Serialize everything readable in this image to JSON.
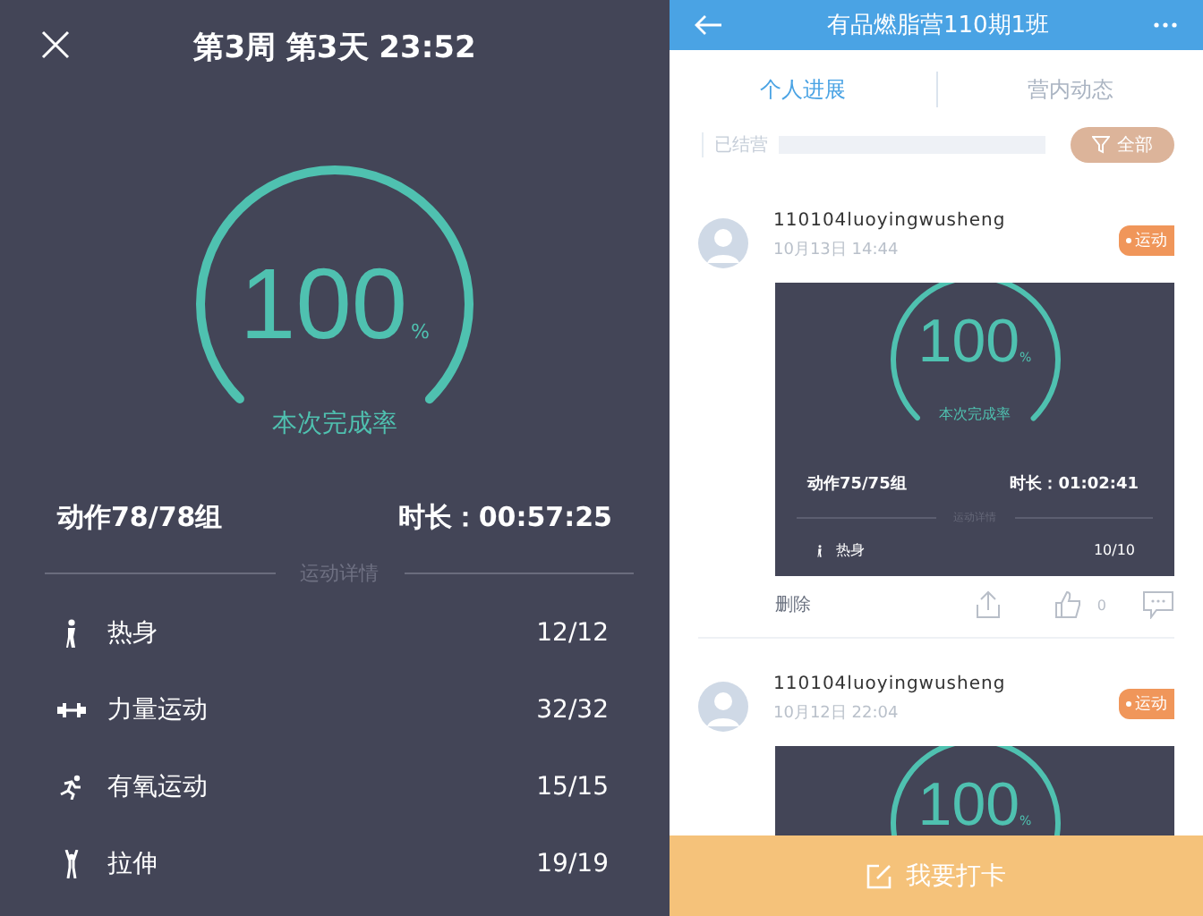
{
  "workout": {
    "title": "第3周 第3天 23:52",
    "completion": {
      "value": "100",
      "unit": "%",
      "label": "本次完成率"
    },
    "sets": "动作78/78组",
    "duration": "时长：00:57:25",
    "details_heading": "运动详情",
    "categories": [
      {
        "kind": "warmup",
        "name": "热身",
        "count": "12/12"
      },
      {
        "kind": "strength",
        "name": "力量运动",
        "count": "32/32"
      },
      {
        "kind": "cardio",
        "name": "有氧运动",
        "count": "15/15"
      },
      {
        "kind": "stretch",
        "name": "拉伸",
        "count": "19/19"
      }
    ]
  },
  "feed": {
    "title": "有品燃脂营110期1班",
    "tabs": [
      {
        "label": "个人进展",
        "selected": true
      },
      {
        "label": "营内动态",
        "selected": false
      }
    ],
    "status_label": "已结营",
    "filter_button": "全部",
    "posts": [
      {
        "user": "110104luoyingwusheng",
        "date": "10月13日  14:44",
        "tag": "运动",
        "card": {
          "value": "100",
          "unit": "%",
          "label": "本次完成率",
          "sets": "动作75/75组",
          "duration": "时长：01:02:41",
          "details_heading": "运动详情",
          "first_row": {
            "kind": "warmup",
            "name": "热身",
            "count": "10/10"
          }
        },
        "actions": {
          "delete": "删除",
          "likes": "0"
        }
      },
      {
        "user": "110104luoyingwusheng",
        "date": "10月12日  22:04",
        "tag": "运动",
        "card": {
          "value": "100",
          "unit": "%"
        }
      }
    ],
    "checkin_button": "我要打卡"
  }
}
